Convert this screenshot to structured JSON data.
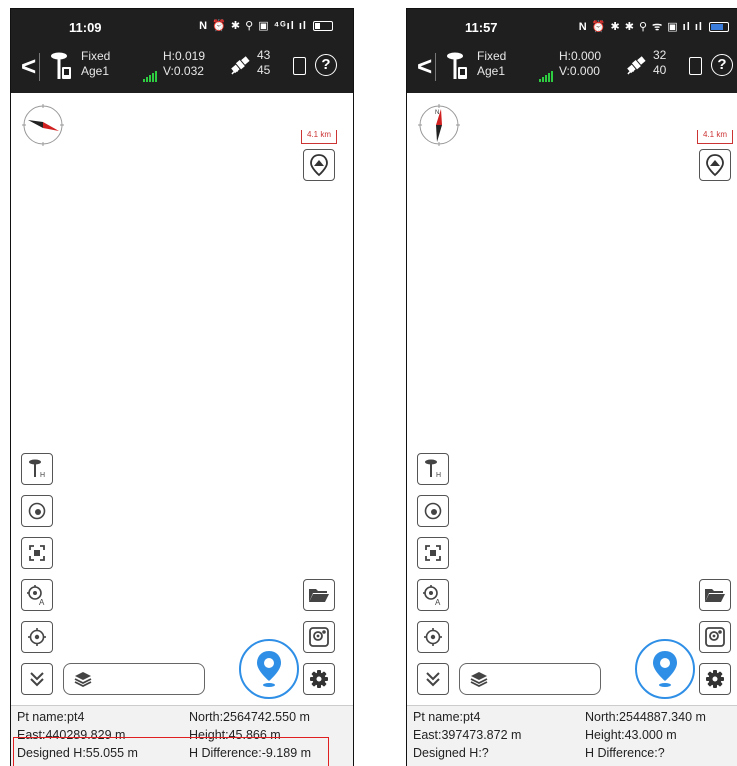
{
  "colors": {
    "topbar": "#1f1f1f",
    "accent": "#2f8fe6",
    "highlight": "#e02020",
    "signal": "#2ecc40",
    "scale": "#cc3333"
  },
  "screens": [
    {
      "status": {
        "time": "11:09",
        "icons": "N ⏰ ✱ ⚲ ▣ ⁴ᴳıl ıl"
      },
      "header": {
        "solution": "Fixed",
        "age": "Age1",
        "h_precision": "H:0.019",
        "v_precision": "V:0.032",
        "sat_used": "43",
        "sat_visible": "45",
        "help": "?"
      },
      "map": {
        "scale_label": "4.1 km"
      },
      "info": {
        "pt_name": "Pt name:pt4",
        "north": "North:2564742.550 m",
        "east": "East:440289.829 m",
        "height": "Height:45.866 m",
        "designed_h": "Designed H:55.055 m",
        "h_difference": "H Difference:-9.189 m"
      }
    },
    {
      "status": {
        "time": "11:57",
        "icons": "N ⏰ ✱ ✱ ⚲ ᯤ ▣ ıl ıl"
      },
      "header": {
        "solution": "Fixed",
        "age": "Age1",
        "h_precision": "H:0.000",
        "v_precision": "V:0.000",
        "sat_used": "32",
        "sat_visible": "40",
        "help": "?"
      },
      "map": {
        "scale_label": "4.1 km"
      },
      "info": {
        "pt_name": "Pt name:pt4",
        "north": "North:2544887.340 m",
        "east": "East:397473.872 m",
        "height": "Height:43.000 m",
        "designed_h": "Designed H:?",
        "h_difference": "H Difference:?"
      }
    }
  ]
}
